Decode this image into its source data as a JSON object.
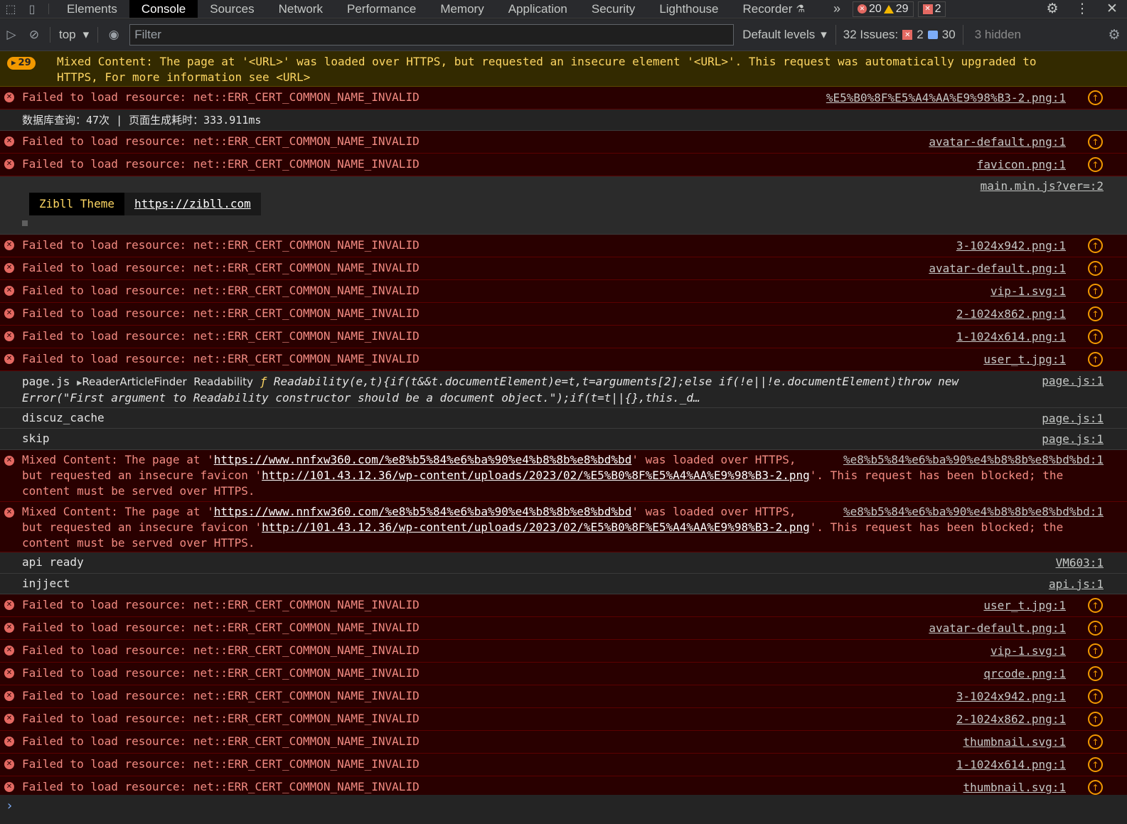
{
  "tabs": [
    "Elements",
    "Console",
    "Sources",
    "Network",
    "Performance",
    "Memory",
    "Application",
    "Security",
    "Lighthouse",
    "Recorder"
  ],
  "active_tab": "Console",
  "counts": {
    "errors": "20",
    "warnings": "29",
    "issues": "2"
  },
  "toolbar": {
    "context": "top",
    "filter_placeholder": "Filter",
    "levels": "Default levels",
    "issues_label": "32 Issues:",
    "issues_errors": "2",
    "issues_messages": "30",
    "hidden": "3 hidden"
  },
  "warn_row": {
    "badge": "29",
    "text": "Mixed Content: The page at '<URL>' was loaded over HTTPS, but requested an insecure element '<URL>'. This request was automatically upgraded to HTTPS, For more information see <URL>"
  },
  "err_text": "Failed to load resource: net::ERR_CERT_COMMON_NAME_INVALID",
  "sources": {
    "r1": "%E5%B0%8F%E5%A4%AA%E9%98%B3-2.png:1",
    "r3": "avatar-default.png:1",
    "r4": "favicon.png:1",
    "r6": "3-1024x942.png:1",
    "r7": "avatar-default.png:1",
    "r8": "vip-1.svg:1",
    "r9": "2-1024x862.png:1",
    "r10": "1-1024x614.png:1",
    "r11": "user_t.jpg:1",
    "r20": "user_t.jpg:1",
    "r21": "avatar-default.png:1",
    "r22": "vip-1.svg:1",
    "r23": "qrcode.png:1",
    "r24": "3-1024x942.png:1",
    "r25": "2-1024x862.png:1",
    "r26": "thumbnail.svg:1",
    "r27": "1-1024x614.png:1",
    "r28": "thumbnail.svg:1"
  },
  "db_log": "数据库查询：47次 | 页面生成耗时：333.911ms",
  "zibll": {
    "source": "main.min.js?ver=:2",
    "label": "Zibll Theme",
    "link": "https://zibll.com"
  },
  "pagejs": {
    "prefix": "page.js",
    "obj": "ReaderArticleFinder",
    "name": "Readability",
    "f": "ƒ",
    "line1": "Readability(e,t){if(t&&t.documentElement)e=t,t=arguments[2];else if(!e||!e.documentElement)throw new",
    "line2": "Error(\"First argument to Readability constructor should be a document object.\");if(t=t||{},this._d…",
    "source": "page.js:1"
  },
  "discuz": {
    "text": "discuz_cache",
    "source": "page.js:1"
  },
  "skip": {
    "text": "skip",
    "source": "page.js:1"
  },
  "mixed": {
    "a": "Mixed Content: The page at '",
    "url1": "https://www.nnfxw360.com/%e8%b5%84%e6%ba%90%e4%b8%8b%e8%bd%bd",
    "b": "' was loaded over HTTPS,",
    "c": "but requested an insecure favicon '",
    "url2": "http://101.43.12.36/wp-content/uploads/2023/02/%E5%B0%8F%E5%A4%AA%E9%98%B3-2.png",
    "d": "'. This request has been blocked; the",
    "e": "content must be served over HTTPS.",
    "source": "%e8%b5%84%e6%ba%90%e4%b8%8b%e8%bd%bd:1"
  },
  "api": {
    "text": "api ready",
    "source": "VM603:1"
  },
  "inject": {
    "text": "injject",
    "source": "api.js:1"
  }
}
